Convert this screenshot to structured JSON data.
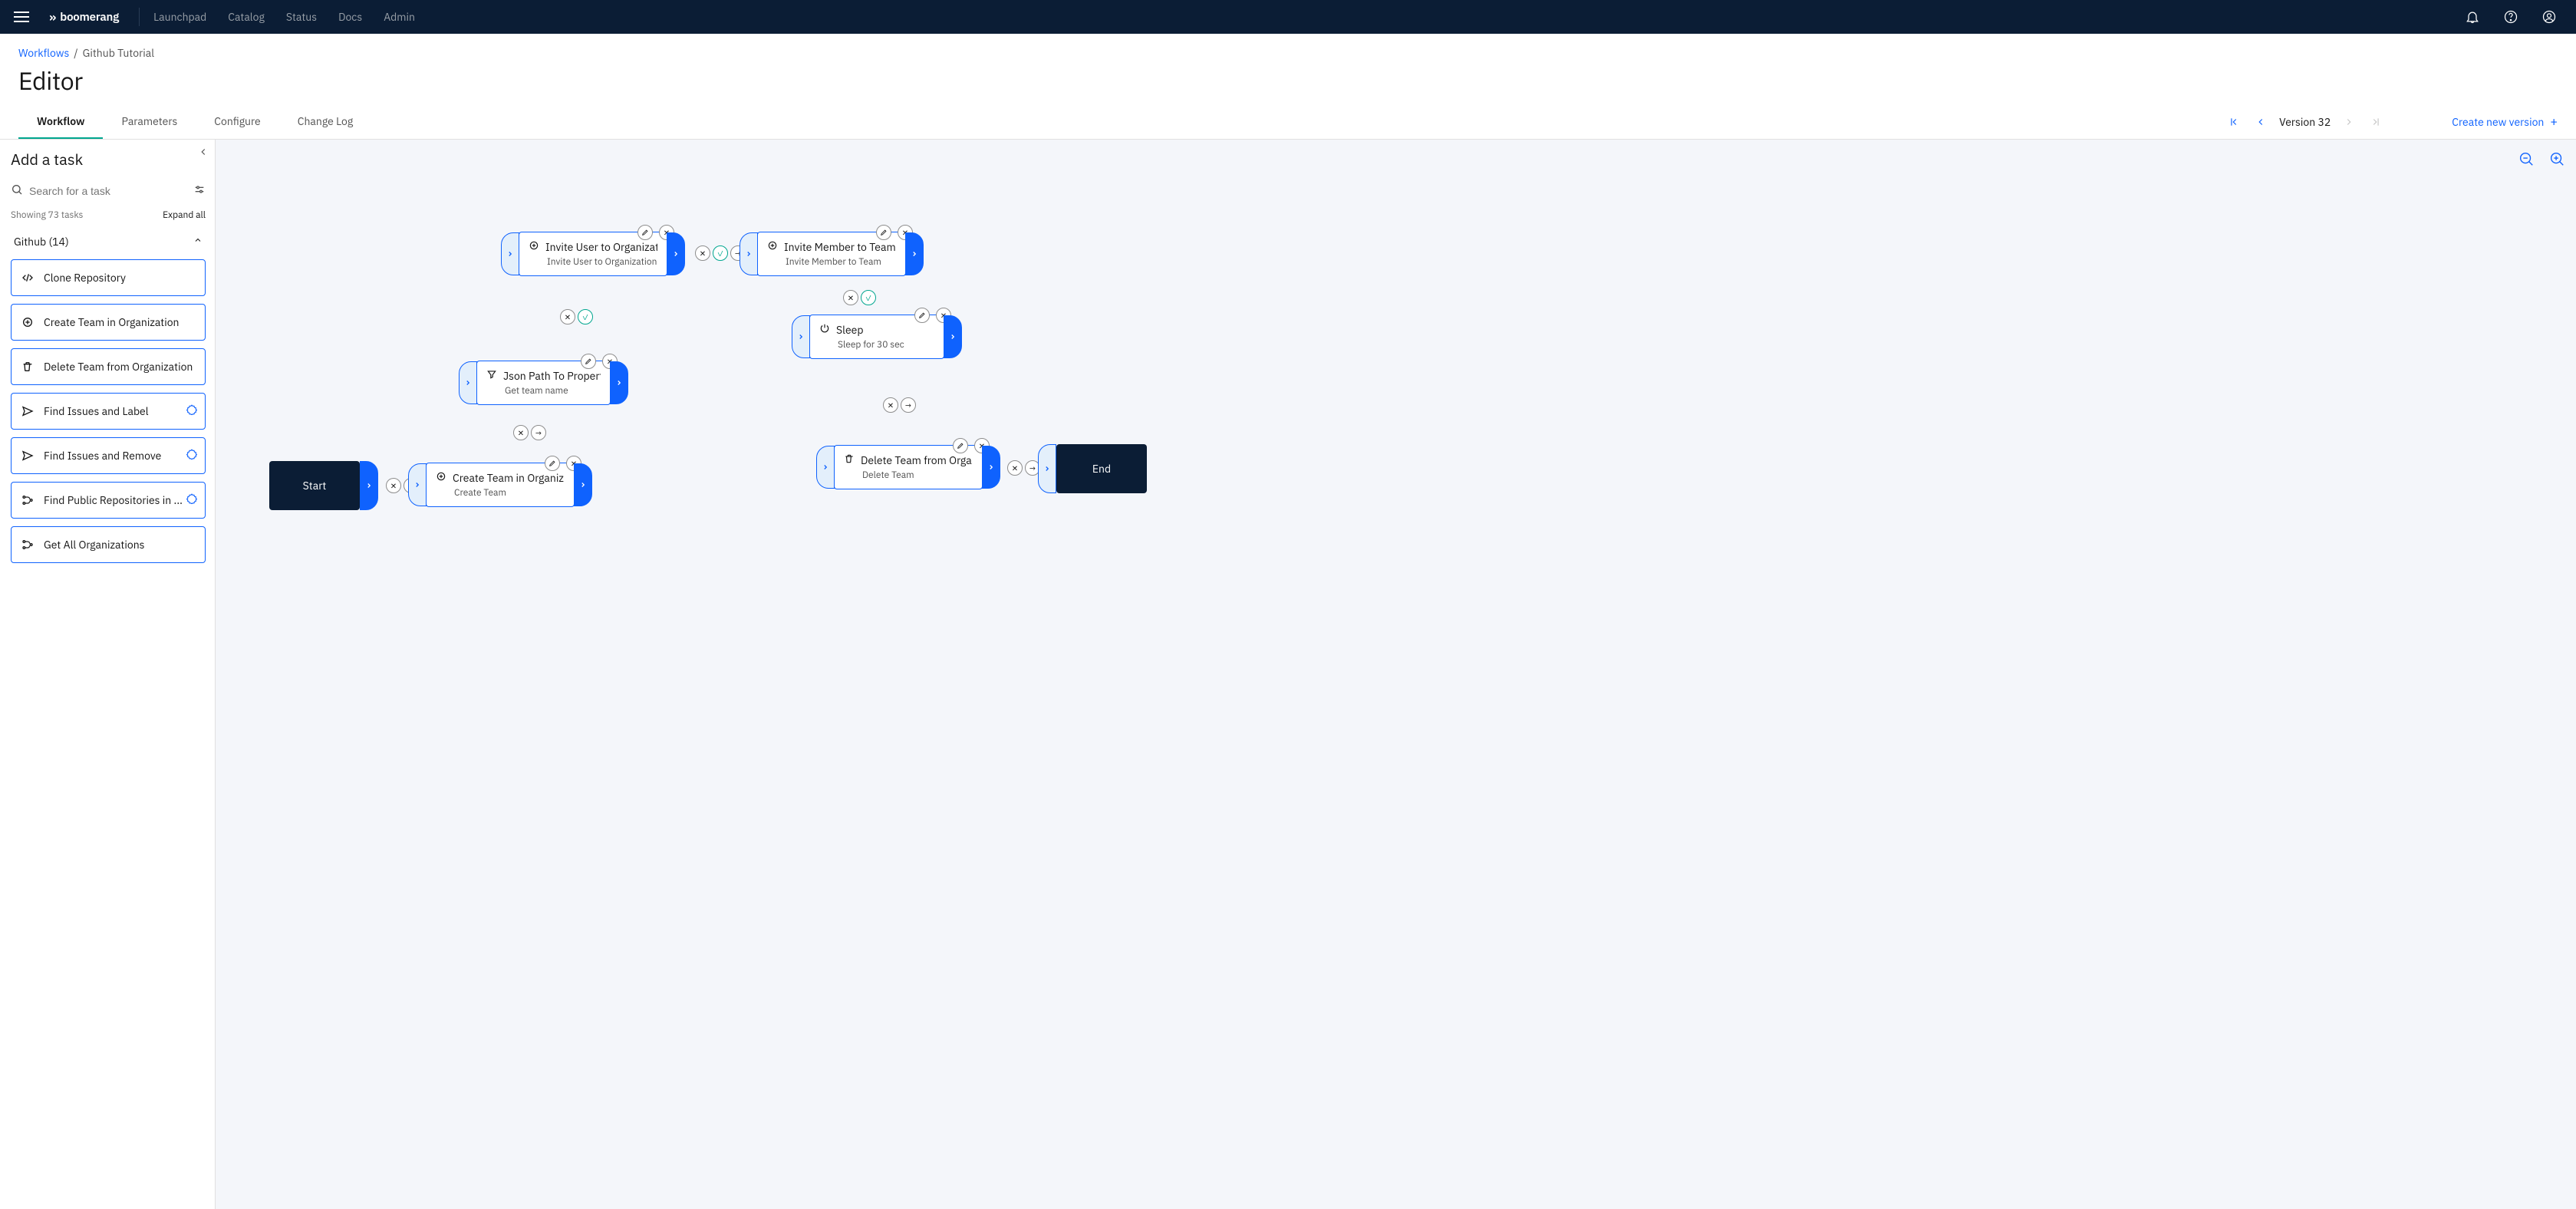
{
  "nav": {
    "brand": "boomerang",
    "links": [
      "Launchpad",
      "Catalog",
      "Status",
      "Docs",
      "Admin"
    ]
  },
  "breadcrumb": {
    "root": "Workflows",
    "current": "Github Tutorial"
  },
  "page_title": "Editor",
  "tabs": [
    "Workflow",
    "Parameters",
    "Configure",
    "Change Log"
  ],
  "active_tab": "Workflow",
  "version": {
    "label": "Version 32"
  },
  "create_version_label": "Create new version",
  "sidebar": {
    "title": "Add a task",
    "search_placeholder": "Search for a task",
    "showing": "Showing 73 tasks",
    "expand": "Expand all",
    "category": "Github (14)",
    "tasks": [
      {
        "label": "Clone Repository",
        "icon": "code",
        "badge": false
      },
      {
        "label": "Create Team in Organization",
        "icon": "add",
        "badge": false
      },
      {
        "label": "Delete Team from Organization",
        "icon": "trash",
        "badge": false
      },
      {
        "label": "Find Issues and Label",
        "icon": "send",
        "badge": true
      },
      {
        "label": "Find Issues and Remove",
        "icon": "send",
        "badge": true
      },
      {
        "label": "Find Public Repositories in ...",
        "icon": "flow",
        "badge": true
      },
      {
        "label": "Get All Organizations",
        "icon": "flow",
        "badge": false
      }
    ]
  },
  "nodes": {
    "start": {
      "label": "Start"
    },
    "end": {
      "label": "End"
    },
    "createTeam": {
      "icon": "add",
      "title": "Create Team in Organiz...",
      "sub": "Create Team"
    },
    "jsonPath": {
      "icon": "filter",
      "title": "Json Path To Property",
      "sub": "Get team name"
    },
    "inviteOrg": {
      "icon": "add",
      "title": "Invite User to Organizat...",
      "sub": "Invite User to Organization"
    },
    "inviteTeam": {
      "icon": "add",
      "title": "Invite Member to Team",
      "sub": "Invite Member to Team"
    },
    "sleep": {
      "icon": "power",
      "title": "Sleep",
      "sub": "Sleep for 30 sec"
    },
    "deleteTeam": {
      "icon": "trash",
      "title": "Delete Team from Orga...",
      "sub": "Delete Team"
    }
  }
}
